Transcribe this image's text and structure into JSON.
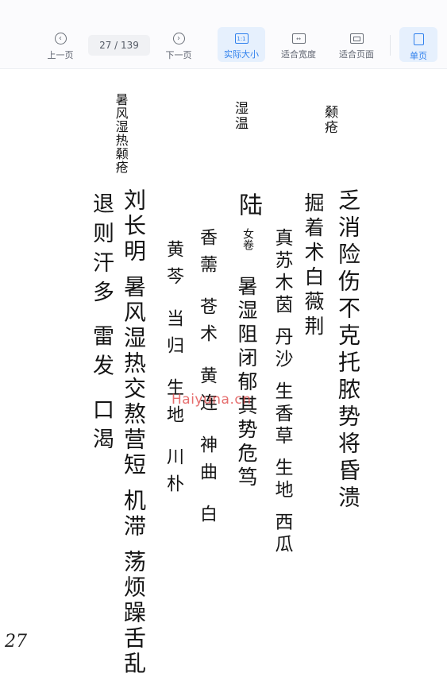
{
  "toolbar": {
    "prev_label": "上一页",
    "current_page": "27",
    "page_sep": " / ",
    "total_pages": "139",
    "next_label": "下一页",
    "actual_size_label": "实际大小",
    "actual_size_icon": "1:1",
    "fit_width_label": "适合宽度",
    "fit_width_icon": "↔",
    "fit_page_label": "适合页面",
    "single_page_label": "单页",
    "accent_color": "#2f80ed"
  },
  "document": {
    "columns": [
      "颡疮",
      "湿温",
      "暑风湿热颡疮",
      "乏消险伤不克托脓势将昏溃",
      "掘着术白薇荆",
      "陆",
      "真苏木茵 丹沙 生香草 生地 西瓜",
      "女卷",
      "暑湿阻闭郁其势危笃",
      "香薷 苍术 黄连 神曲 白",
      "黄芩 当归 生地 川朴",
      "刘长明 暑风湿热交熬营短 机滞 荡烦躁舌乱",
      "退则汗多 雷发 口渴"
    ],
    "watermark": "Haiyuna.cn",
    "page_number": "27"
  }
}
